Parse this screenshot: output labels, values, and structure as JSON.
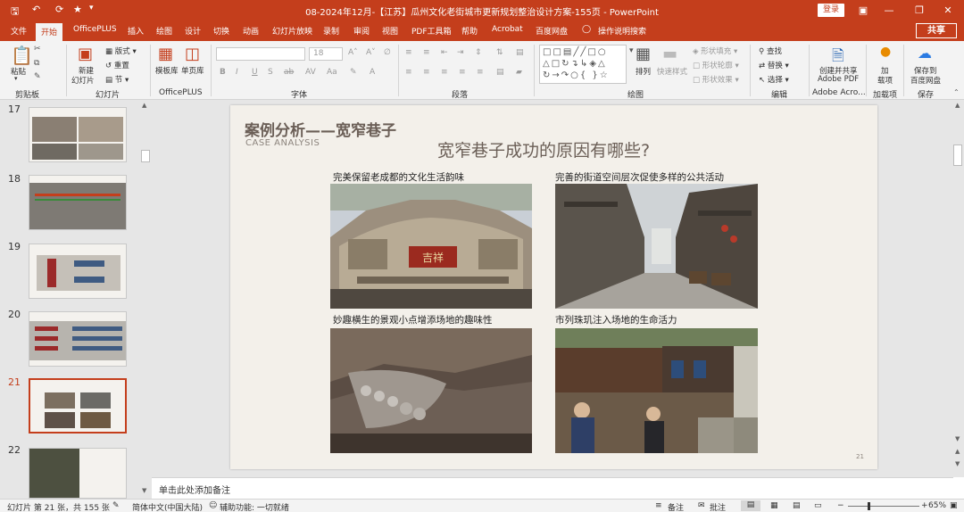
{
  "titlebar": {
    "title": "08-2024年12月-【江苏】瓜州文化老街城市更新规划整治设计方案-155页 - PowerPoint",
    "login": "登录",
    "save_icon": "save-icon",
    "undo_icon": "undo-icon",
    "redo_icon": "redo-icon",
    "accent": "#c43e1c"
  },
  "tabs": [
    "文件",
    "开始",
    "OfficePLUS",
    "插入",
    "绘图",
    "设计",
    "切换",
    "动画",
    "幻灯片放映",
    "录制",
    "审阅",
    "视图",
    "PDF工具箱",
    "帮助",
    "Acrobat",
    "百度网盘"
  ],
  "tell_me": "操作说明搜索",
  "share": "共享",
  "ribbon": {
    "clipboard": {
      "paste": "粘贴",
      "label": "剪贴板"
    },
    "slides": {
      "new_slide": "新建",
      "new_slide2": "幻灯片",
      "layout": "版式",
      "reset": "重置",
      "section": "节",
      "label": "幻灯片"
    },
    "officeplus": {
      "template": "模板库",
      "single": "单页库",
      "label": "OfficePLUS"
    },
    "font": {
      "size": "18",
      "label": "字体"
    },
    "paragraph": {
      "label": "段落"
    },
    "drawing": {
      "arrange": "排列",
      "quick_styles": "快速样式",
      "fill": "形状填充",
      "outline": "形状轮廓",
      "effects": "形状效果",
      "label": "绘图"
    },
    "editing": {
      "find": "查找",
      "replace": "替换",
      "select": "选择",
      "label": "编辑"
    },
    "adobe": {
      "create": "创建并共享",
      "create2": "Adobe PDF",
      "label": "Adobe Acro..."
    },
    "addins": {
      "add": "加",
      "add2": "载项",
      "label": "加载项"
    },
    "save": {
      "save_to": "保存到",
      "save_to2": "百度网盘",
      "label": "保存"
    }
  },
  "thumbnails": [
    {
      "num": "17"
    },
    {
      "num": "18"
    },
    {
      "num": "19"
    },
    {
      "num": "20"
    },
    {
      "num": "21",
      "selected": true
    },
    {
      "num": "22"
    }
  ],
  "slide": {
    "heading": "案例分析——宽窄巷子",
    "heading_en": "CASE ANALYSIS",
    "question": "宽窄巷子成功的原因有哪些?",
    "captions": [
      "完美保留老成都的文化生活韵味",
      "完善的街道空间层次促使多样的公共活动",
      "妙趣横生的景观小点增添场地的趣味性",
      "市列珠玑注入场地的生命活力"
    ],
    "sign_text": "吉祥",
    "page_number": "21"
  },
  "notes_placeholder": "单击此处添加备注",
  "status": {
    "slide_info": "幻灯片 第 21 张，共 155 张",
    "language": "简体中文(中国大陆)",
    "accessibility": "辅助功能: 一切就绪",
    "notes": "备注",
    "comments": "批注",
    "zoom": "65%"
  }
}
